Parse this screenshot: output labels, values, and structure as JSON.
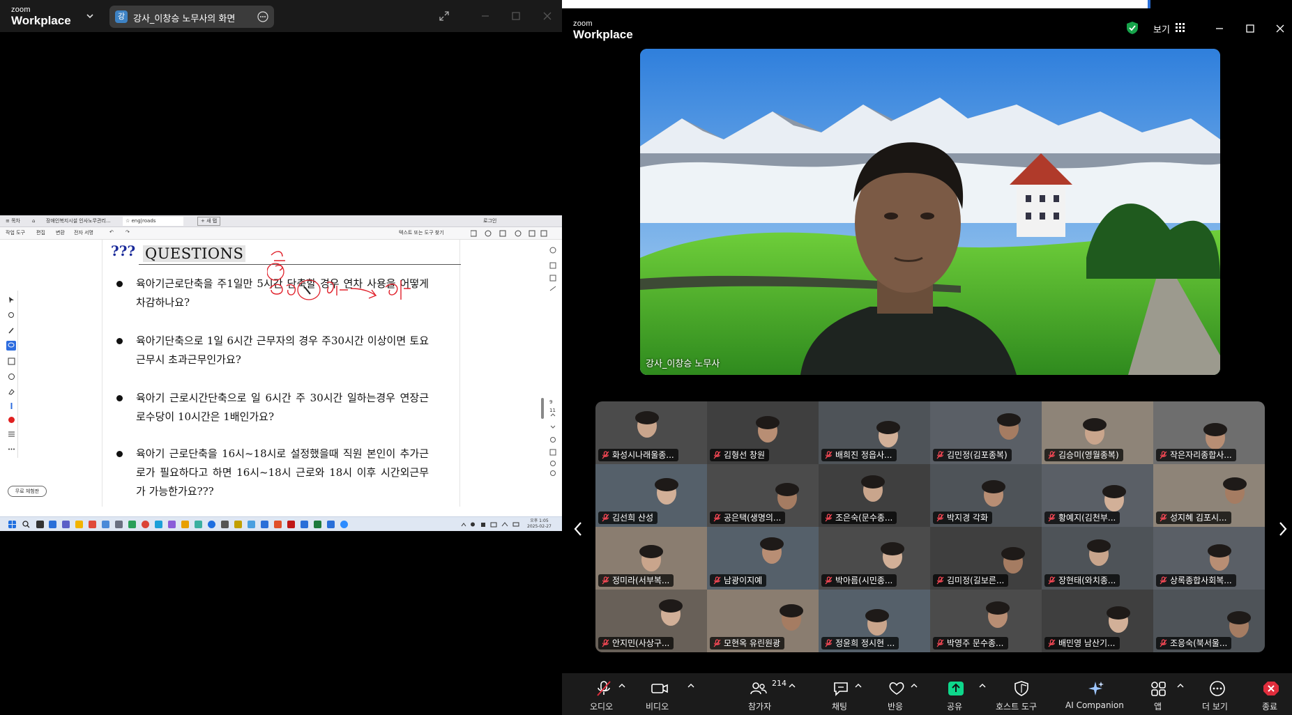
{
  "left_window": {
    "logo_line1": "zoom",
    "logo_line2": "Workplace",
    "screen_tab": {
      "avatar": "강",
      "label": "강사_이창승 노무사의 화면"
    }
  },
  "shared_screen": {
    "browser_tabs": [
      "≡ 목차",
      "⌂",
      "장애인복지시설 인사노무관리...",
      "☆ eng|roads",
      "+ 새 탭"
    ],
    "login_label": "로그인",
    "menu_items": [
      "작업 도구",
      "편집",
      "변환",
      "전자 서명",
      "↶",
      "↷",
      "텍스트 또는 도구 찾기"
    ],
    "free_trial_button": "무료 체험판",
    "heading_marks": "???",
    "heading": "QUESTIONS",
    "questions": [
      "육아기근로단축을 주1일만 5시간 단축할 경우 연차 사용을 어떻게 차감하나요?",
      "육아기단축으로 1일 6시간 근무자의 경우 주30시간 이상이면 토요근무시 초과근무인가요?",
      "육아기 근로시간단축으로 일 6시간 주 30시간 일하는경우 연장근로수당이 10시간은 1배인가요?",
      "육아기 근로단축을 16시~18시로 설정했을때 직원 본인이 추가근로가 필요하다고 하면 16시~18시 근로와 18시 이후 시간외근무가 가능한가요???"
    ],
    "page_indicator": [
      "9",
      "11"
    ],
    "clock": [
      "오후 1:05",
      "2025-02-27"
    ]
  },
  "meeting": {
    "logo_line1": "zoom",
    "logo_line2": "Workplace",
    "view_label": "보기",
    "speaker_name": "강사_이창승 노무사",
    "participants": [
      "화성시나래울종...",
      "김형선 창원",
      "배희진 정읍사...",
      "김민정(김포종복)",
      "김승미(영월종복)",
      "작은자리종합사...",
      "김선희 산성",
      "공은택(생명의...",
      "조은숙(문수종...",
      "박지경 각화",
      "황예지(김천부...",
      "성지혜 김포시...",
      "정미라(서부복...",
      "남광이지예",
      "박아름(시민종...",
      "김미정(길보른...",
      "장현태(와치종...",
      "상록종합사회복...",
      "안지민(사상구...",
      "모현옥 유린원광",
      "정윤희 정시현 ...",
      "박영주 문수종...",
      "배민영 남산기...",
      "조응숙(북서울..."
    ],
    "toolbar": {
      "audio": "오디오",
      "video": "비디오",
      "participants": "참가자",
      "participant_count": "214",
      "chat": "채팅",
      "reactions": "반응",
      "share": "공유",
      "host_tools": "호스트 도구",
      "ai_companion": "AI Companion",
      "apps": "앱",
      "more": "더 보기",
      "end": "종료"
    }
  },
  "colors": {
    "share_green": "#0ed78b",
    "end_red": "#e02d3c",
    "mic_off_red": "#e02d3c",
    "shield_green": "#16a34a"
  }
}
